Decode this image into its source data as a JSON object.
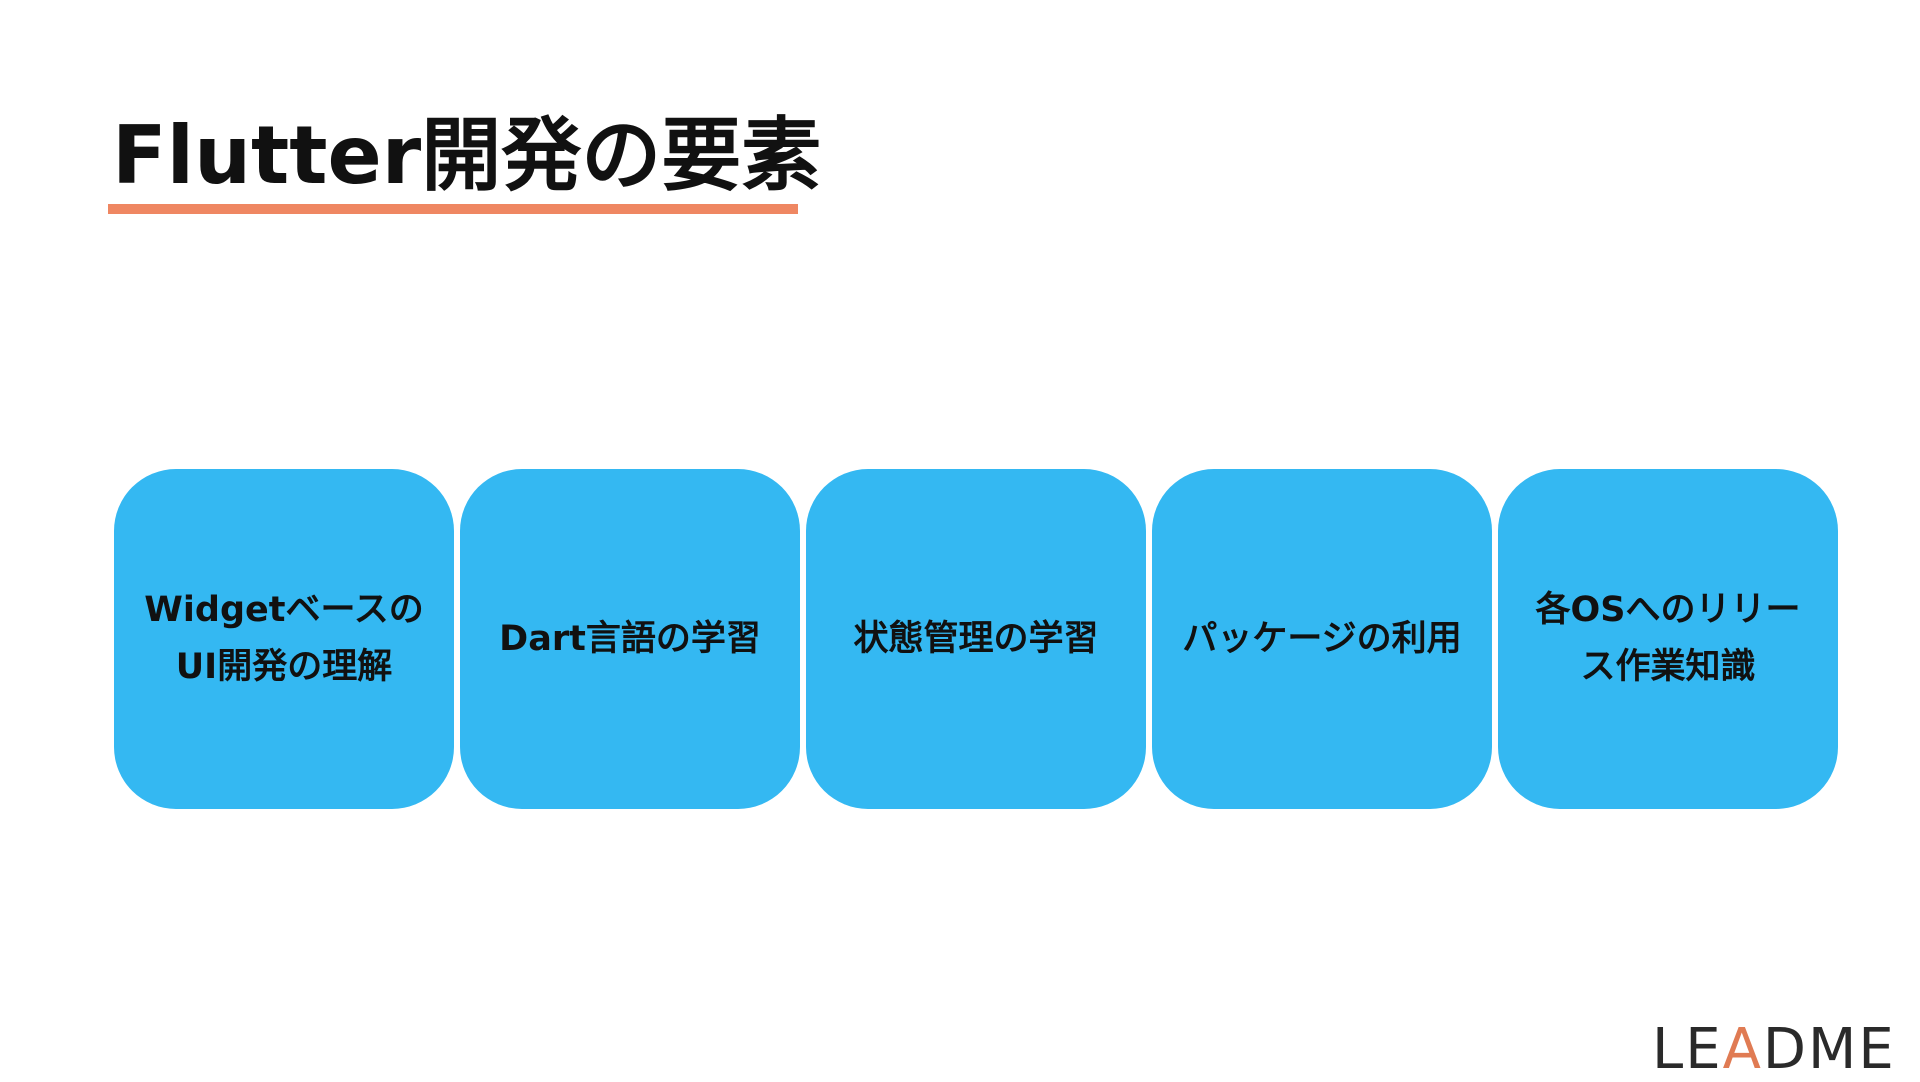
{
  "slide": {
    "title": "Flutter開発の要素",
    "accent_color": "#ef8762",
    "card_color": "#34b8f2",
    "cards": [
      {
        "label": "Widgetベースの\nUI開発の理解"
      },
      {
        "label": "Dart言語の学習"
      },
      {
        "label": "状態管理の学習"
      },
      {
        "label": "パッケージの利用"
      },
      {
        "label": "各OSへのリリー\nス作業知識"
      }
    ]
  },
  "logo": {
    "text_part1": "LE",
    "text_accent": "A",
    "text_part2": "DME"
  }
}
